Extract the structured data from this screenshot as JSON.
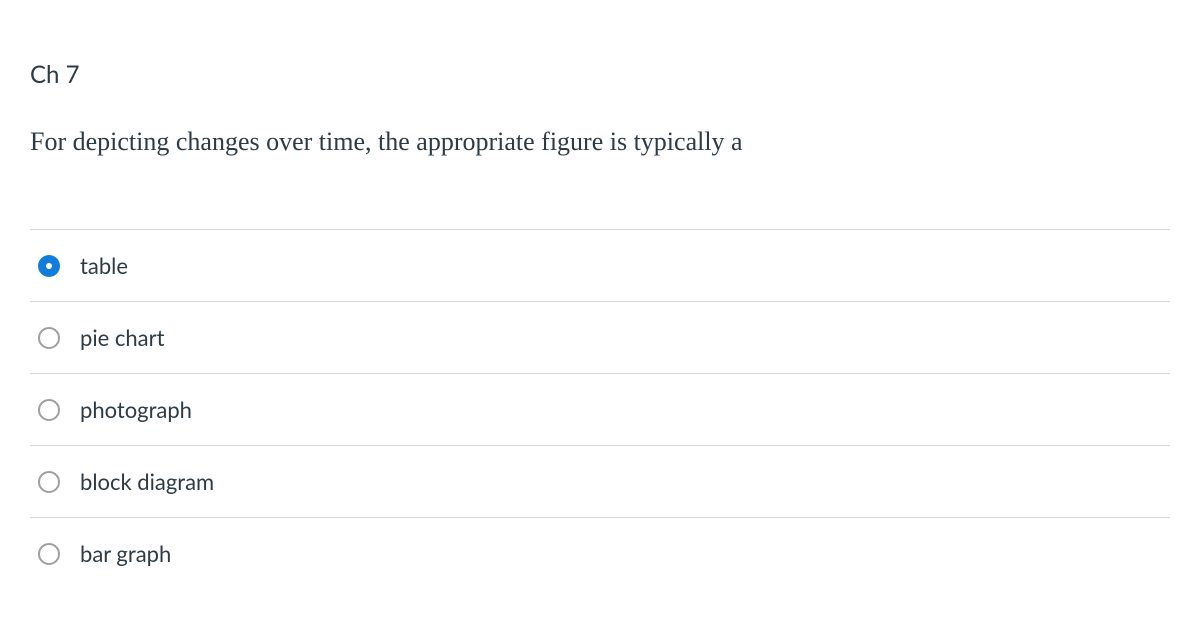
{
  "chapter": "Ch 7",
  "question": "For depicting changes over time, the appropriate figure is typically a",
  "options": [
    {
      "label": "table",
      "selected": true
    },
    {
      "label": "pie chart",
      "selected": false
    },
    {
      "label": "photograph",
      "selected": false
    },
    {
      "label": "block diagram",
      "selected": false
    },
    {
      "label": "bar graph",
      "selected": false
    }
  ]
}
